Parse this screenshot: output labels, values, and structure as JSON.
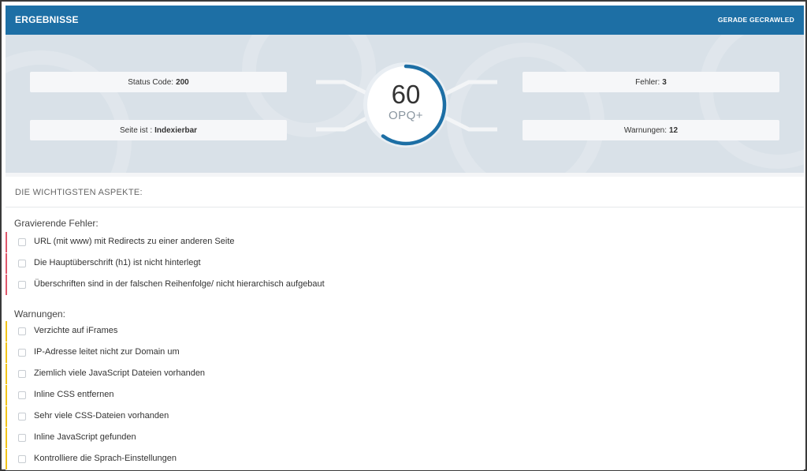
{
  "header": {
    "title": "ERGEBNISSE",
    "status": "GERADE GECRAWLED"
  },
  "stats": {
    "status_code_label": "Status Code:",
    "status_code_value": "200",
    "index_label": "Seite ist :",
    "index_value": "Indexierbar",
    "errors_label": "Fehler:",
    "errors_value": "3",
    "warnings_label": "Warnungen:",
    "warnings_value": "12"
  },
  "score": {
    "value": "60",
    "label": "OPQ+",
    "progress": 0.6
  },
  "aspects": {
    "title": "DIE WICHTIGSTEN ASPEKTE:",
    "errors_title": "Gravierende Fehler:",
    "errors": [
      "URL (mit www) mit Redirects zu einer anderen Seite",
      "Die Hauptüberschrift (h1) ist nicht hinterlegt",
      "Überschriften sind in der falschen Reihenfolge/ nicht hierarchisch aufgebaut"
    ],
    "warnings_title": "Warnungen:",
    "warnings": [
      "Verzichte auf iFrames",
      "IP-Adresse leitet nicht zur Domain um",
      "Ziemlich viele JavaScript Dateien vorhanden",
      "Inline CSS entfernen",
      "Sehr viele CSS-Dateien vorhanden",
      "Inline JavaScript gefunden",
      "Kontrolliere die Sprach-Einstellungen"
    ]
  },
  "colors": {
    "accent": "#1d6fa5",
    "error": "#e0566b",
    "warning": "#f2c419"
  }
}
